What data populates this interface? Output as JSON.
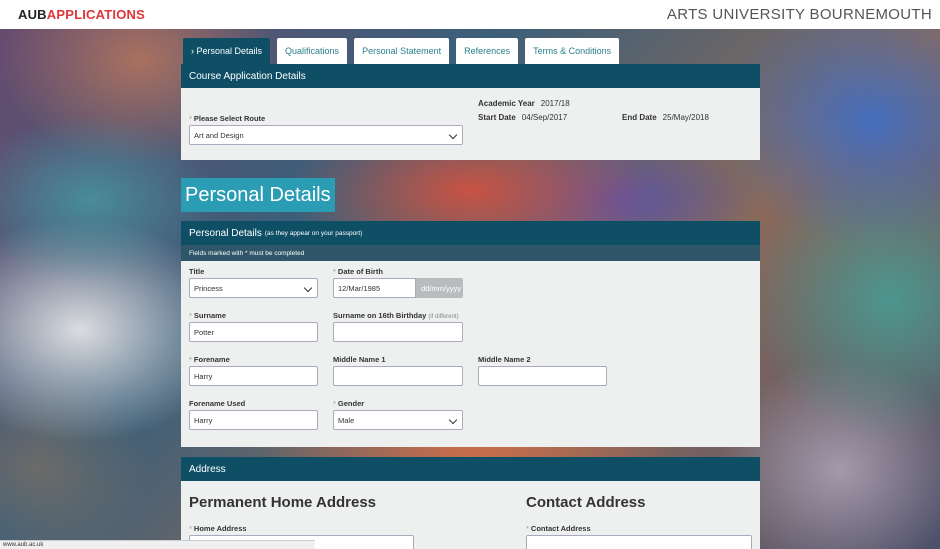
{
  "header": {
    "logo_part1": "AUB",
    "logo_part2": "APPLICATIONS",
    "university": "ARTS UNIVERSITY BOURNEMOUTH"
  },
  "tabs": [
    {
      "label": "› Personal Details",
      "active": true
    },
    {
      "label": "Qualifications",
      "active": false
    },
    {
      "label": "Personal Statement",
      "active": false
    },
    {
      "label": "References",
      "active": false
    },
    {
      "label": "Terms & Conditions",
      "active": false
    }
  ],
  "course": {
    "heading": "Course Application Details",
    "route_label": "Please Select Route",
    "route_value": "Art and Design",
    "academic_year_label": "Academic Year",
    "academic_year": "2017/18",
    "start_date_label": "Start Date",
    "start_date": "04/Sep/2017",
    "end_date_label": "End Date",
    "end_date": "25/May/2018"
  },
  "page_title": "Personal Details",
  "personal": {
    "heading": "Personal Details",
    "heading_note": "(as they appear on your passport)",
    "note": "Fields marked with * must be completed",
    "title_label": "Title",
    "title_value": "Princess",
    "dob_label": "Date of Birth",
    "dob_value": "12/Mar/1985",
    "dob_format": "dd/mm/yyyy",
    "surname_label": "Surname",
    "surname_value": "Potter",
    "surname16_label": "Surname on 16th Birthday",
    "surname16_hint": "(if different)",
    "surname16_value": "",
    "forename_label": "Forename",
    "forename_value": "Harry",
    "middle1_label": "Middle Name 1",
    "middle1_value": "",
    "middle2_label": "Middle Name 2",
    "middle2_value": "",
    "forename_used_label": "Forename Used",
    "forename_used_value": "Harry",
    "gender_label": "Gender",
    "gender_value": "Male"
  },
  "address": {
    "heading": "Address",
    "permanent_title": "Permanent Home Address",
    "home_label": "Home Address",
    "contact_title": "Contact Address",
    "contact_label": "Contact Address"
  },
  "status_url": "www.aub.ac.uk"
}
